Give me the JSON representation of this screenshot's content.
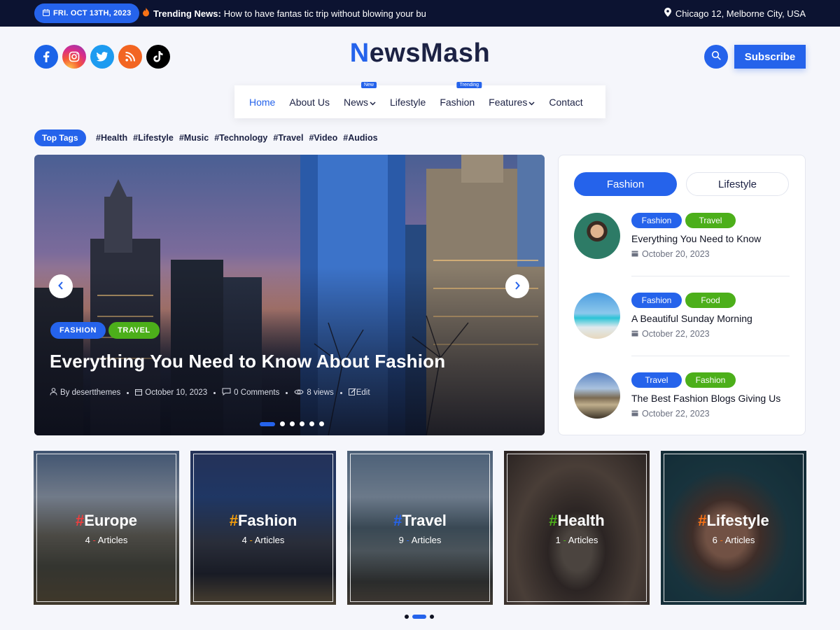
{
  "topbar": {
    "date": "FRI. OCT 13TH, 2023",
    "trending_label": "Trending News:",
    "trending_text": "How to have fantas tic trip without blowing your bu",
    "location": "Chicago 12, Melborne City, USA"
  },
  "header": {
    "logo_first": "N",
    "logo_rest": "ewsMash",
    "subscribe_label": "Subscribe",
    "social_icons": [
      "facebook-icon",
      "instagram-icon",
      "twitter-icon",
      "rss-icon",
      "tiktok-icon"
    ]
  },
  "nav": {
    "items": [
      {
        "label": "Home",
        "active": true
      },
      {
        "label": "About Us"
      },
      {
        "label": "News",
        "badge": "New",
        "dropdown": true
      },
      {
        "label": "Lifestyle"
      },
      {
        "label": "Fashion",
        "badge": "Trending"
      },
      {
        "label": "Features",
        "dropdown": true
      },
      {
        "label": "Contact"
      }
    ]
  },
  "tags": {
    "title": "Top Tags",
    "items": [
      "#Health",
      "#Lifestyle",
      "#Music",
      "#Technology",
      "#Travel",
      "#Video",
      "#Audios"
    ]
  },
  "hero": {
    "categories": [
      {
        "label": "FASHION",
        "color": "#2563eb"
      },
      {
        "label": "TRAVEL",
        "color": "#4caf1a"
      }
    ],
    "title": "Everything You Need to Know About Fashion",
    "author": "By desertthemes",
    "date": "October 10, 2023",
    "comments": "0 Comments",
    "views": "8 views",
    "edit": "Edit",
    "slides": 6,
    "active_slide": 1
  },
  "sidebar": {
    "tabs": [
      {
        "label": "Fashion",
        "active": true
      },
      {
        "label": "Lifestyle",
        "active": false
      }
    ],
    "posts": [
      {
        "cats": [
          {
            "label": "Fashion",
            "color": "#2563eb"
          },
          {
            "label": "Travel",
            "color": "#4caf1a"
          }
        ],
        "title": "Everything You Need to Know",
        "date": "October 20, 2023"
      },
      {
        "cats": [
          {
            "label": "Fashion",
            "color": "#2563eb"
          },
          {
            "label": "Food",
            "color": "#4caf1a"
          }
        ],
        "title": "A Beautiful Sunday Morning",
        "date": "October 22, 2023"
      },
      {
        "cats": [
          {
            "label": "Travel",
            "color": "#2563eb"
          },
          {
            "label": "Fashion",
            "color": "#4caf1a"
          }
        ],
        "title": "The Best Fashion Blogs Giving Us",
        "date": "October 22, 2023"
      }
    ]
  },
  "categories": [
    {
      "name": "Europe",
      "hash_color": "#ef3e3e",
      "count": "4",
      "dash_color": "#ef3e3e",
      "label": "Articles"
    },
    {
      "name": "Fashion",
      "hash_color": "#f59e0b",
      "count": "4",
      "dash_color": "#f59e0b",
      "label": "Articles"
    },
    {
      "name": "Travel",
      "hash_color": "#2563eb",
      "count": "9",
      "dash_color": "#2563eb",
      "label": "Articles"
    },
    {
      "name": "Health",
      "hash_color": "#4caf1a",
      "count": "1",
      "dash_color": "#4caf1a",
      "label": "Articles"
    },
    {
      "name": "Lifestyle",
      "hash_color": "#f97316",
      "count": "6",
      "dash_color": "#f97316",
      "label": "Articles"
    }
  ],
  "colors": {
    "accent": "#2563eb",
    "green": "#4caf1a",
    "dark": "#0c1331"
  }
}
